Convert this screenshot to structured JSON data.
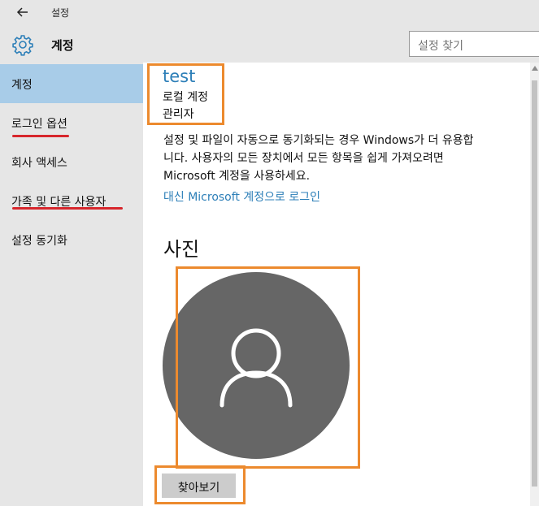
{
  "window": {
    "title": "설정"
  },
  "header": {
    "title": "계정",
    "search": {
      "placeholder": "설정 찾기"
    }
  },
  "sidebar": {
    "items": [
      {
        "label": "계정",
        "selected": true
      },
      {
        "label": "로그인 옵션",
        "selected": false
      },
      {
        "label": "회사 액세스",
        "selected": false
      },
      {
        "label": "가족 및 다른 사용자",
        "selected": false
      },
      {
        "label": "설정 동기화",
        "selected": false
      }
    ]
  },
  "account": {
    "name": "test",
    "type": "로컬 계정",
    "role": "관리자",
    "description_line1": "설정 및 파일이 자동으로 동기화되는 경우 Windows가 더 유용합",
    "description_line2": "니다. 사용자의 모든 장치에서 모든 항목을 쉽게 가져오려면",
    "description_line3": "Microsoft 계정을 사용하세요.",
    "ms_signin_link": "대신 Microsoft 계정으로 로그인"
  },
  "photo": {
    "heading": "사진",
    "browse_label": "찾아보기"
  },
  "colors": {
    "accent": "#2d7fb8",
    "selection": "#a8cce8",
    "highlight_box": "#ec8a2e",
    "underline": "#d7262c",
    "avatar_bg": "#666666"
  },
  "icons": {
    "back": "back-arrow-icon",
    "settings": "gear-icon",
    "avatar": "user-silhouette-icon"
  }
}
